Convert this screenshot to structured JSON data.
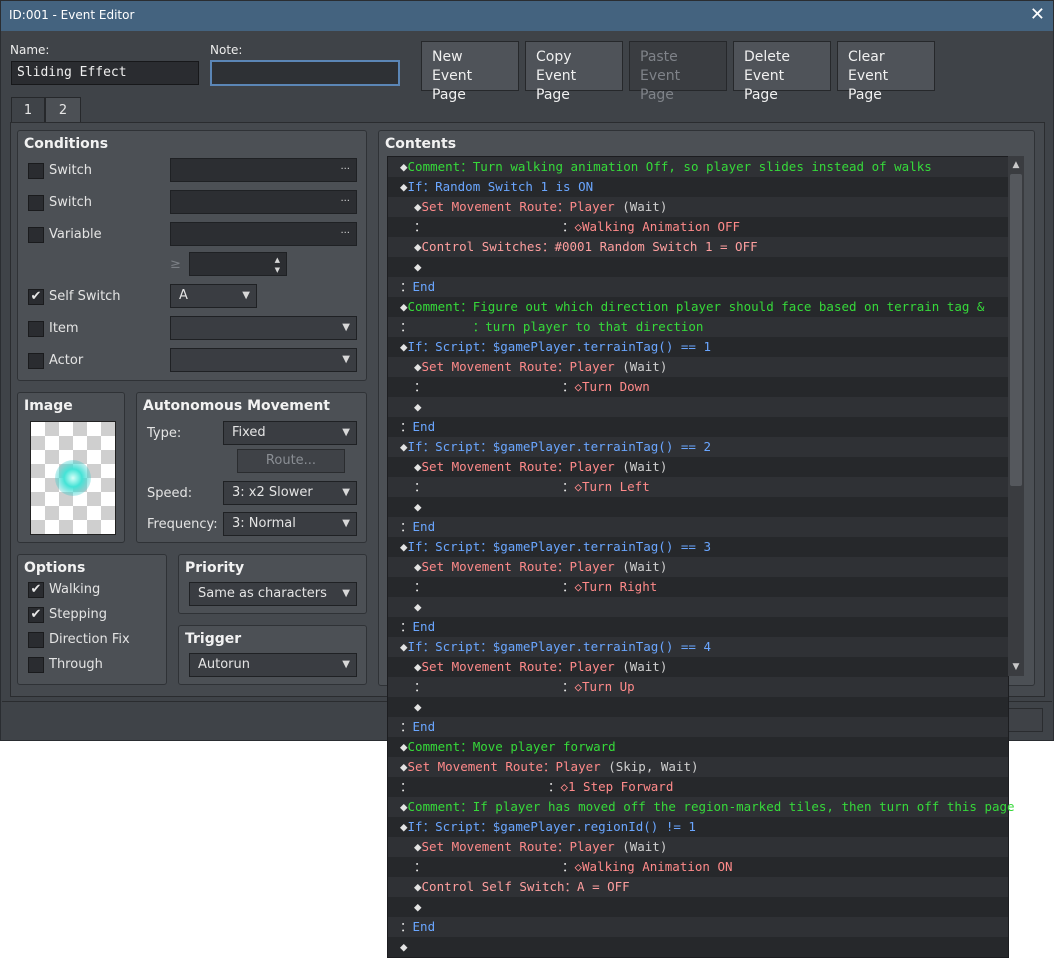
{
  "window": {
    "title": "ID:001 - Event Editor"
  },
  "fields": {
    "name_label": "Name:",
    "name_value": "Sliding Effect",
    "note_label": "Note:",
    "note_value": ""
  },
  "toolbar": [
    {
      "l1": "New",
      "l2": "Event Page",
      "enabled": true
    },
    {
      "l1": "Copy",
      "l2": "Event Page",
      "enabled": true
    },
    {
      "l1": "Paste",
      "l2": "Event Page",
      "enabled": false
    },
    {
      "l1": "Delete",
      "l2": "Event Page",
      "enabled": true
    },
    {
      "l1": "Clear",
      "l2": "Event Page",
      "enabled": true
    }
  ],
  "tabs": [
    {
      "label": "1",
      "active": false
    },
    {
      "label": "2",
      "active": true
    }
  ],
  "conditions": {
    "title": "Conditions",
    "switch1": "Switch",
    "switch2": "Switch",
    "variable": "Variable",
    "ge": "≥",
    "self_switch": "Self Switch",
    "self_switch_value": "A",
    "self_switch_checked": true,
    "item": "Item",
    "actor": "Actor"
  },
  "image": {
    "title": "Image"
  },
  "movement": {
    "title": "Autonomous Movement",
    "type_label": "Type:",
    "type_value": "Fixed",
    "route_button": "Route...",
    "speed_label": "Speed:",
    "speed_value": "3: x2 Slower",
    "freq_label": "Frequency:",
    "freq_value": "3: Normal"
  },
  "options": {
    "title": "Options",
    "items": [
      {
        "label": "Walking",
        "checked": true
      },
      {
        "label": "Stepping",
        "checked": true
      },
      {
        "label": "Direction Fix",
        "checked": false
      },
      {
        "label": "Through",
        "checked": false
      }
    ]
  },
  "priority": {
    "title": "Priority",
    "value": "Same as characters"
  },
  "trigger": {
    "title": "Trigger",
    "value": "Autorun"
  },
  "contents": {
    "title": "Contents",
    "lines": [
      {
        "i": 0,
        "s": [
          [
            "◆",
            "dia"
          ],
          [
            "Comment：Turn walking animation Off, so player slides instead of walks",
            "c-comment"
          ]
        ]
      },
      {
        "i": 0,
        "s": [
          [
            "◆",
            "dia"
          ],
          [
            "If：Random Switch 1 is ON",
            "c-if"
          ]
        ]
      },
      {
        "i": 1,
        "s": [
          [
            "◆",
            "dia"
          ],
          [
            "Set Movement Route：Player ",
            "c-move"
          ],
          [
            "(Wait)",
            "c-gray"
          ]
        ]
      },
      {
        "i": 1,
        "s": [
          [
            "：                  ：",
            "c-plain"
          ],
          [
            "◇Walking Animation OFF",
            "c-move"
          ]
        ]
      },
      {
        "i": 1,
        "s": [
          [
            "◆",
            "dia"
          ],
          [
            "Control Switches：#0001 Random Switch 1 = OFF",
            "c-ctrl"
          ]
        ]
      },
      {
        "i": 1,
        "s": [
          [
            "◆",
            "dia"
          ]
        ]
      },
      {
        "i": 0,
        "s": [
          [
            "：",
            "c-plain"
          ],
          [
            "End",
            "c-if"
          ]
        ]
      },
      {
        "i": 0,
        "s": [
          [
            "◆",
            "dia"
          ],
          [
            "Comment：Figure out which direction player should face based on terrain tag &",
            "c-comment"
          ]
        ]
      },
      {
        "i": 0,
        "s": [
          [
            "：        ",
            "c-plain"
          ],
          [
            "：turn player to that direction",
            "c-comment"
          ]
        ]
      },
      {
        "i": 0,
        "s": [
          [
            "◆",
            "dia"
          ],
          [
            "If：Script：$gamePlayer.terrainTag() == 1",
            "c-if"
          ]
        ]
      },
      {
        "i": 1,
        "s": [
          [
            "◆",
            "dia"
          ],
          [
            "Set Movement Route：Player ",
            "c-move"
          ],
          [
            "(Wait)",
            "c-gray"
          ]
        ]
      },
      {
        "i": 1,
        "s": [
          [
            "：                  ：",
            "c-plain"
          ],
          [
            "◇Turn Down",
            "c-move"
          ]
        ]
      },
      {
        "i": 1,
        "s": [
          [
            "◆",
            "dia"
          ]
        ]
      },
      {
        "i": 0,
        "s": [
          [
            "：",
            "c-plain"
          ],
          [
            "End",
            "c-if"
          ]
        ]
      },
      {
        "i": 0,
        "s": [
          [
            "◆",
            "dia"
          ],
          [
            "If：Script：$gamePlayer.terrainTag() == 2",
            "c-if"
          ]
        ]
      },
      {
        "i": 1,
        "s": [
          [
            "◆",
            "dia"
          ],
          [
            "Set Movement Route：Player ",
            "c-move"
          ],
          [
            "(Wait)",
            "c-gray"
          ]
        ]
      },
      {
        "i": 1,
        "s": [
          [
            "：                  ：",
            "c-plain"
          ],
          [
            "◇Turn Left",
            "c-move"
          ]
        ]
      },
      {
        "i": 1,
        "s": [
          [
            "◆",
            "dia"
          ]
        ]
      },
      {
        "i": 0,
        "s": [
          [
            "：",
            "c-plain"
          ],
          [
            "End",
            "c-if"
          ]
        ]
      },
      {
        "i": 0,
        "s": [
          [
            "◆",
            "dia"
          ],
          [
            "If：Script：$gamePlayer.terrainTag() == 3",
            "c-if"
          ]
        ]
      },
      {
        "i": 1,
        "s": [
          [
            "◆",
            "dia"
          ],
          [
            "Set Movement Route：Player ",
            "c-move"
          ],
          [
            "(Wait)",
            "c-gray"
          ]
        ]
      },
      {
        "i": 1,
        "s": [
          [
            "：                  ：",
            "c-plain"
          ],
          [
            "◇Turn Right",
            "c-move"
          ]
        ]
      },
      {
        "i": 1,
        "s": [
          [
            "◆",
            "dia"
          ]
        ]
      },
      {
        "i": 0,
        "s": [
          [
            "：",
            "c-plain"
          ],
          [
            "End",
            "c-if"
          ]
        ]
      },
      {
        "i": 0,
        "s": [
          [
            "◆",
            "dia"
          ],
          [
            "If：Script：$gamePlayer.terrainTag() == 4",
            "c-if"
          ]
        ]
      },
      {
        "i": 1,
        "s": [
          [
            "◆",
            "dia"
          ],
          [
            "Set Movement Route：Player ",
            "c-move"
          ],
          [
            "(Wait)",
            "c-gray"
          ]
        ]
      },
      {
        "i": 1,
        "s": [
          [
            "：                  ：",
            "c-plain"
          ],
          [
            "◇Turn Up",
            "c-move"
          ]
        ]
      },
      {
        "i": 1,
        "s": [
          [
            "◆",
            "dia"
          ]
        ]
      },
      {
        "i": 0,
        "s": [
          [
            "：",
            "c-plain"
          ],
          [
            "End",
            "c-if"
          ]
        ]
      },
      {
        "i": 0,
        "s": [
          [
            "◆",
            "dia"
          ],
          [
            "Comment：Move player forward",
            "c-comment"
          ]
        ]
      },
      {
        "i": 0,
        "s": [
          [
            "◆",
            "dia"
          ],
          [
            "Set Movement Route：Player ",
            "c-move"
          ],
          [
            "(Skip, Wait)",
            "c-gray"
          ]
        ]
      },
      {
        "i": 0,
        "s": [
          [
            "：                  ：",
            "c-plain"
          ],
          [
            "◇1 Step Forward",
            "c-move"
          ]
        ]
      },
      {
        "i": 0,
        "s": [
          [
            "◆",
            "dia"
          ],
          [
            "Comment：If player has moved off the region-marked tiles, then turn off this page",
            "c-comment"
          ]
        ]
      },
      {
        "i": 0,
        "s": [
          [
            "◆",
            "dia"
          ],
          [
            "If：Script：$gamePlayer.regionId() != 1",
            "c-if"
          ]
        ]
      },
      {
        "i": 1,
        "s": [
          [
            "◆",
            "dia"
          ],
          [
            "Set Movement Route：Player ",
            "c-move"
          ],
          [
            "(Wait)",
            "c-gray"
          ]
        ]
      },
      {
        "i": 1,
        "s": [
          [
            "：                  ：",
            "c-plain"
          ],
          [
            "◇Walking Animation ON",
            "c-move"
          ]
        ]
      },
      {
        "i": 1,
        "s": [
          [
            "◆",
            "dia"
          ],
          [
            "Control Self Switch：A = OFF",
            "c-ctrl"
          ]
        ]
      },
      {
        "i": 1,
        "s": [
          [
            "◆",
            "dia"
          ]
        ]
      },
      {
        "i": 0,
        "s": [
          [
            "：",
            "c-plain"
          ],
          [
            "End",
            "c-if"
          ]
        ]
      },
      {
        "i": 0,
        "s": [
          [
            "◆",
            "dia"
          ]
        ]
      }
    ]
  },
  "icons": {
    "close": "close-icon",
    "dots": "ellipsis-icon",
    "arrow": "chevron-down-icon",
    "check": "check-icon"
  }
}
